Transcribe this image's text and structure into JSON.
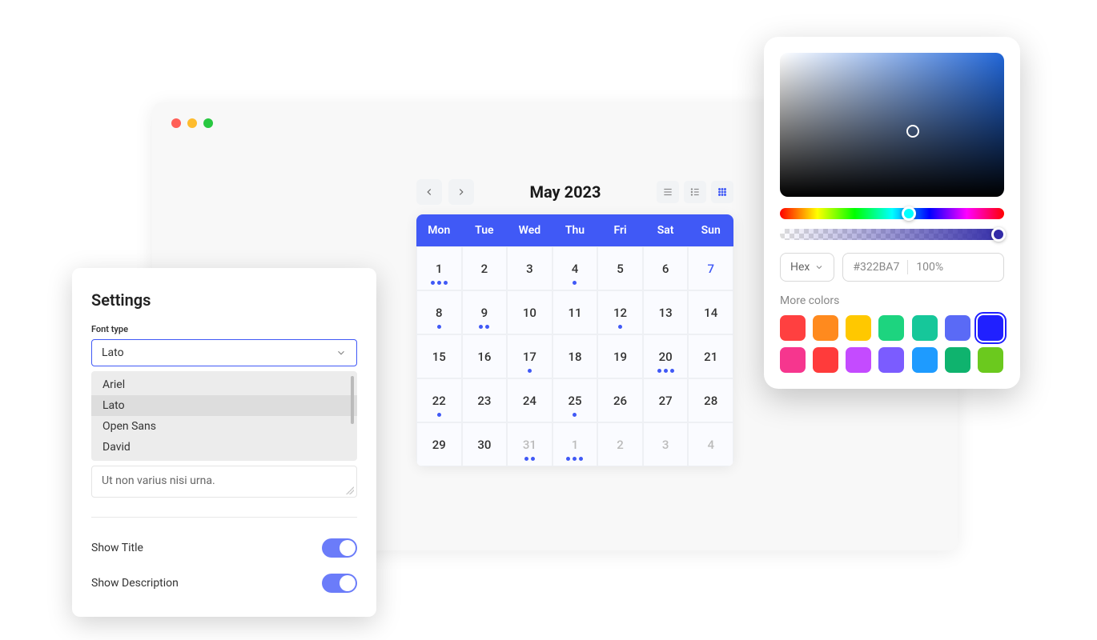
{
  "settings": {
    "title": "Settings",
    "font_type_label": "Font type",
    "selected_font": "Lato",
    "font_options": [
      "Ariel",
      "Lato",
      "Open Sans",
      "David"
    ],
    "textarea_text": "Ut non varius nisi urna.",
    "show_title_label": "Show Title",
    "show_description_label": "Show Description",
    "show_title_on": true,
    "show_description_on": true
  },
  "calendar": {
    "title": "May 2023",
    "weekdays": [
      "Mon",
      "Tue",
      "Wed",
      "Thu",
      "Fri",
      "Sat",
      "Sun"
    ],
    "weeks": [
      [
        {
          "n": "1",
          "dots": 3
        },
        {
          "n": "2"
        },
        {
          "n": "3"
        },
        {
          "n": "4",
          "dots": 1
        },
        {
          "n": "5"
        },
        {
          "n": "6"
        },
        {
          "n": "7",
          "blue": true
        }
      ],
      [
        {
          "n": "8",
          "dots": 1
        },
        {
          "n": "9",
          "dots": 2
        },
        {
          "n": "10"
        },
        {
          "n": "11"
        },
        {
          "n": "12",
          "dots": 1
        },
        {
          "n": "13"
        },
        {
          "n": "14"
        }
      ],
      [
        {
          "n": "15"
        },
        {
          "n": "16"
        },
        {
          "n": "17",
          "dots": 1
        },
        {
          "n": "18"
        },
        {
          "n": "19"
        },
        {
          "n": "20",
          "dots": 3
        },
        {
          "n": "21"
        }
      ],
      [
        {
          "n": "22",
          "dots": 1
        },
        {
          "n": "23"
        },
        {
          "n": "24"
        },
        {
          "n": "25",
          "dots": 1
        },
        {
          "n": "26"
        },
        {
          "n": "27"
        },
        {
          "n": "28"
        }
      ],
      [
        {
          "n": "29"
        },
        {
          "n": "30"
        },
        {
          "n": "31",
          "dots": 2,
          "other": true
        },
        {
          "n": "1",
          "dots": 3,
          "other": true
        },
        {
          "n": "2",
          "other": true
        },
        {
          "n": "3",
          "other": true
        },
        {
          "n": "4",
          "other": true
        }
      ]
    ]
  },
  "color_picker": {
    "format_label": "Hex",
    "hex_value": "#322BA7",
    "opacity": "100%",
    "more_colors_label": "More colors",
    "swatches": [
      "#ff4040",
      "#ff8a1e",
      "#ffc800",
      "#1dd47f",
      "#16c79a",
      "#5a6af6",
      "#2020ff",
      "#f6368e",
      "#ff3b3b",
      "#c44bff",
      "#7b5cff",
      "#1e9bff",
      "#0fb36e",
      "#6bc91e"
    ],
    "selected_swatch_index": 6
  }
}
